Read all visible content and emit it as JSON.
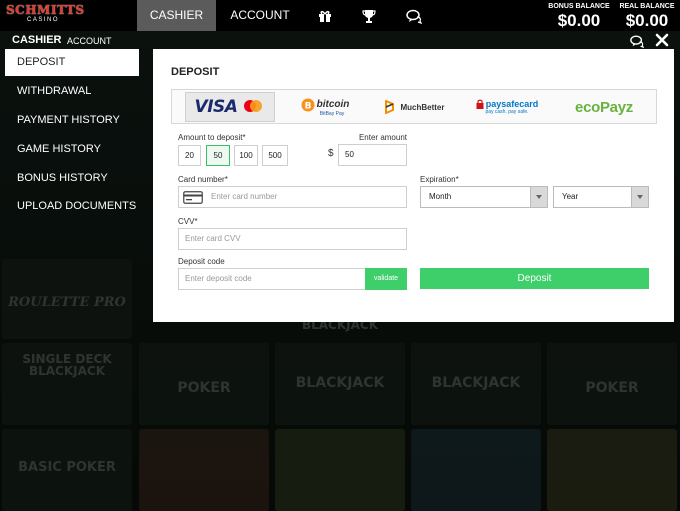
{
  "logo": {
    "main": "SCHMITTS",
    "sub": "CASINO"
  },
  "topnav": {
    "cashier": "CASHIER",
    "account": "ACCOUNT"
  },
  "balances": {
    "bonus_label": "BONUS BALANCE",
    "bonus_value": "$0.00",
    "real_label": "REAL BALANCE",
    "real_value": "$0.00"
  },
  "cashier_header": {
    "title": "CASHIER",
    "account": "ACCOUNT"
  },
  "sidebar": {
    "items": [
      {
        "label": "DEPOSIT"
      },
      {
        "label": "WITHDRAWAL"
      },
      {
        "label": "PAYMENT HISTORY"
      },
      {
        "label": "GAME HISTORY"
      },
      {
        "label": "BONUS HISTORY"
      },
      {
        "label": "UPLOAD DOCUMENTS"
      }
    ]
  },
  "panel": {
    "title": "DEPOSIT",
    "methods": [
      "VISA",
      "bitcoin",
      "MuchBetter",
      "paysafecard",
      "ecoPayz"
    ],
    "method_subtexts": {
      "bitcoin": "BitBay Pay",
      "paysafecard": "pay cash. pay safe."
    },
    "amount_label": "Amount to deposit*",
    "amounts": [
      "20",
      "50",
      "100",
      "500"
    ],
    "enter_amount_label": "Enter amount",
    "currency": "$",
    "amount_value": "50",
    "card_label": "Card number*",
    "card_placeholder": "Enter card number",
    "expiration_label": "Expiration*",
    "month": "Month",
    "year": "Year",
    "cvv_label": "CVV*",
    "cvv_placeholder": "Enter card CVV",
    "code_label": "Deposit code",
    "code_placeholder": "Enter deposit code",
    "validate": "validate",
    "deposit": "Deposit"
  },
  "background_games": [
    "SINGLE DECK BLACKJACK",
    "POKER",
    "BLACKJACK",
    "BLACKJACK",
    "POKER",
    "BASIC POKER",
    "ROULETTE PRO",
    "BLACKJACK"
  ],
  "colors": {
    "accent": "#3ecf6b",
    "logo_red": "#e23a2e",
    "active_tab": "#5b5b5b"
  }
}
